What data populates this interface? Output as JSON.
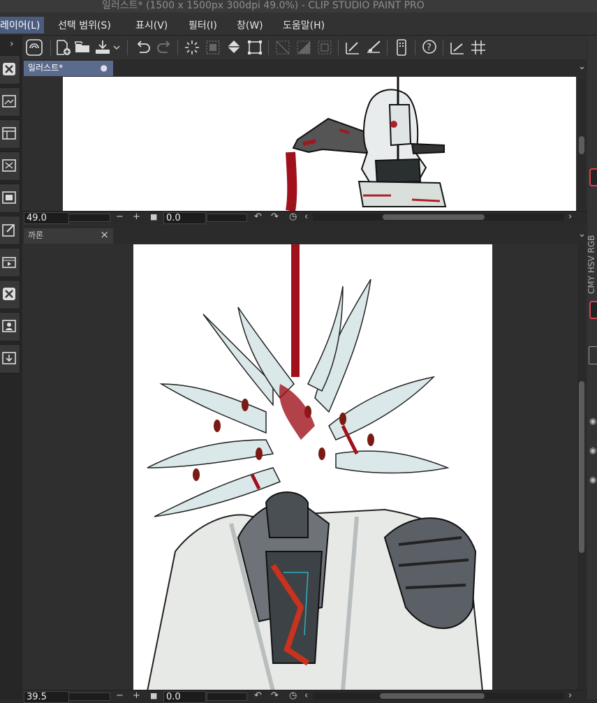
{
  "window": {
    "title": "일러스트* (1500 x 1500px 300dpi 49.0%)  - CLIP STUDIO PAINT PRO"
  },
  "menu": [
    {
      "label": "레이어(L)"
    },
    {
      "label": "선택 범위(S)"
    },
    {
      "label": "표시(V)"
    },
    {
      "label": "필터(I)"
    },
    {
      "label": "창(W)"
    },
    {
      "label": "도움말(H)"
    }
  ],
  "canvas_top": {
    "tab_label": "일러스트*",
    "zoom": "49.0",
    "angle": "0.0"
  },
  "canvas_bottom": {
    "tab_label": "까론",
    "zoom": "39.5",
    "angle": "0.0"
  },
  "colors": {
    "accent": "#4b5c80",
    "blood": "#a0111b",
    "highlight_border": "#d7424e"
  },
  "right_panel": {
    "tab_text": "CMY HSV RGB"
  }
}
